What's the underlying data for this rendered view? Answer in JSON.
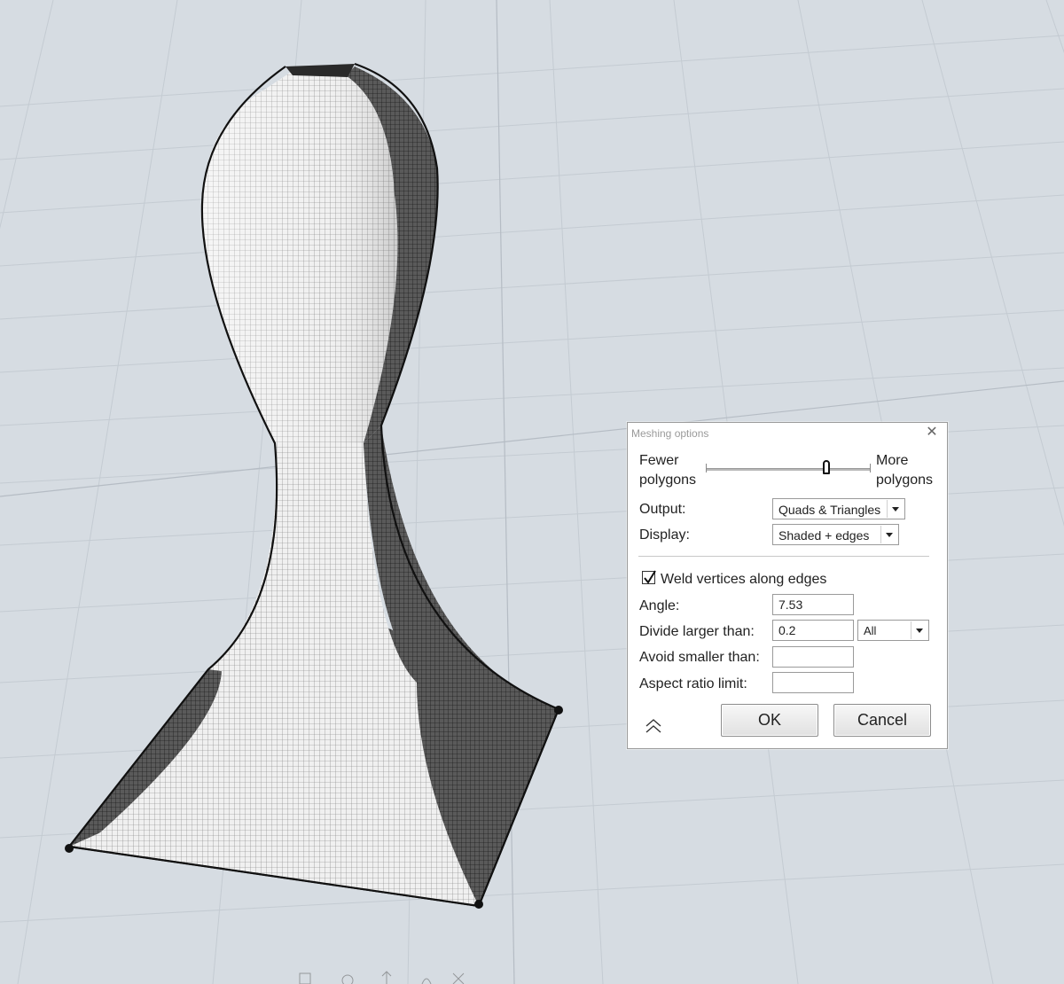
{
  "dialog": {
    "title": "Meshing options",
    "close_label": "✕",
    "slider": {
      "left_label": "Fewer\npolygons",
      "left_line1": "Fewer",
      "left_line2": "polygons",
      "right_line1": "More",
      "right_line2": "polygons",
      "position": 0.73
    },
    "output_label": "Output:",
    "output_value": "Quads & Triangles",
    "display_label": "Display:",
    "display_value": "Shaded + edges",
    "weld_label": "Weld vertices along edges",
    "weld_checked": true,
    "angle_label": "Angle:",
    "angle_value": "7.53",
    "divide_label": "Divide larger than:",
    "divide_value": "0.2",
    "divide_scope": "All",
    "avoid_label": "Avoid smaller than:",
    "avoid_value": "",
    "aspect_label": "Aspect ratio limit:",
    "aspect_value": "",
    "ok_label": "OK",
    "cancel_label": "Cancel"
  },
  "colors": {
    "background": "#d6dce2",
    "grid_line": "#c2c9d0",
    "mesh_light": "#ededed",
    "mesh_dark": "#3c3c3c"
  }
}
